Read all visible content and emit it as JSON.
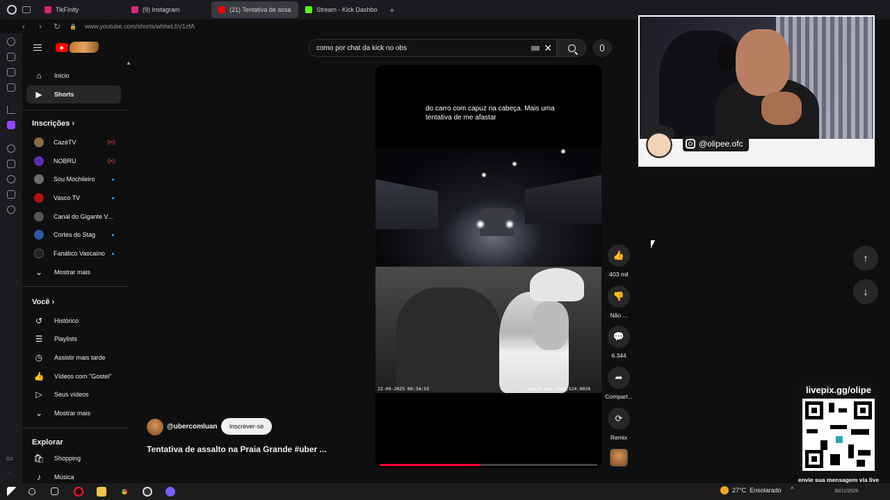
{
  "browser": {
    "tabs": [
      {
        "label": "TikFinity",
        "color": "#e0245e"
      },
      {
        "label": "(9) Instagram",
        "color": "#d62976"
      },
      {
        "label": "(21) Tentativa de assa",
        "color": "#ff0000",
        "active": true
      },
      {
        "label": "Stream - Kick Dashbo",
        "color": "#53fc18"
      }
    ],
    "new_tab": "+",
    "url": "www.youtube.com/shorts/whheLbV1zfA",
    "back_icon": "‹",
    "forward_icon": "›",
    "reload_icon": "↻"
  },
  "rail": {
    "gx_label": "GX",
    "more": "···"
  },
  "sidebar": {
    "primary": [
      {
        "label": "Início",
        "icon": "⌂"
      },
      {
        "label": "Shorts",
        "icon": "▶",
        "selected": true
      }
    ],
    "subscriptions_title": "Inscrições",
    "subscriptions": [
      {
        "label": "CazéTV",
        "live": true,
        "color": "#8a6a4a"
      },
      {
        "label": "NOBRU",
        "live": true,
        "color": "#5b2fb5"
      },
      {
        "label": "Sou Mochileiro",
        "dot": true,
        "color": "#6c6c6c"
      },
      {
        "label": "Vasco TV",
        "dot": true,
        "color": "#b01010"
      },
      {
        "label": "Canal do Gigante V...",
        "color": "#555"
      },
      {
        "label": "Cortes do Stag",
        "dot": true,
        "color": "#2b5aa8"
      },
      {
        "label": "Fanático Vascaíno",
        "dot": true,
        "color": "#222"
      }
    ],
    "show_more": "Mostrar mais",
    "you_title": "Você",
    "you_items": [
      {
        "label": "Histórico",
        "icon": "↺"
      },
      {
        "label": "Playlists",
        "icon": "☰"
      },
      {
        "label": "Assistir mais tarde",
        "icon": "◷"
      },
      {
        "label": "Vídeos com \"Gostei\"",
        "icon": "👍"
      },
      {
        "label": "Seus vídeos",
        "icon": "▷"
      },
      {
        "label": "Mostrar mais",
        "icon": "⌄"
      }
    ],
    "explore_title": "Explorar",
    "explore_items": [
      {
        "label": "Shopping",
        "icon": "🛍"
      },
      {
        "label": "Música",
        "icon": "♪"
      }
    ],
    "live_icon": "((•))",
    "chevron": "›"
  },
  "search": {
    "value": "como por chat da kick no obs",
    "clear": "✕"
  },
  "video": {
    "caption": "do carro com capuz na cabeça. Mais uma tentativa de me afastar",
    "timestamp": "22-09-2025 00:34:55",
    "telemetry": "0km/h W46.4080,S24.0029",
    "progress": 0.46
  },
  "channel": {
    "name": "@ubercomluan",
    "subscribe": "Inscrever-se"
  },
  "title": "Tentativa de assalto na Praia Grande #uber ...",
  "actions": [
    {
      "label": "403 mil",
      "icon": "👍",
      "name": "like-button"
    },
    {
      "label": "Não ...",
      "icon": "👎",
      "name": "dislike-button"
    },
    {
      "label": "6.344",
      "icon": "💬",
      "name": "comments-button"
    },
    {
      "label": "Compart...",
      "icon": "➦",
      "name": "share-button"
    },
    {
      "label": "Remix",
      "icon": "⟳",
      "name": "remix-button"
    }
  ],
  "nav": {
    "up": "↑",
    "down": "↓"
  },
  "overlay": {
    "instagram": "@olipee.ofc",
    "pix_title": "livepix.gg/olipe",
    "pix_sub": "envie sua mensagem via live pix"
  },
  "taskbar": {
    "temperature": "27°C",
    "weather": "Ensolarado",
    "tray": "^",
    "date": "30/11/2025"
  }
}
